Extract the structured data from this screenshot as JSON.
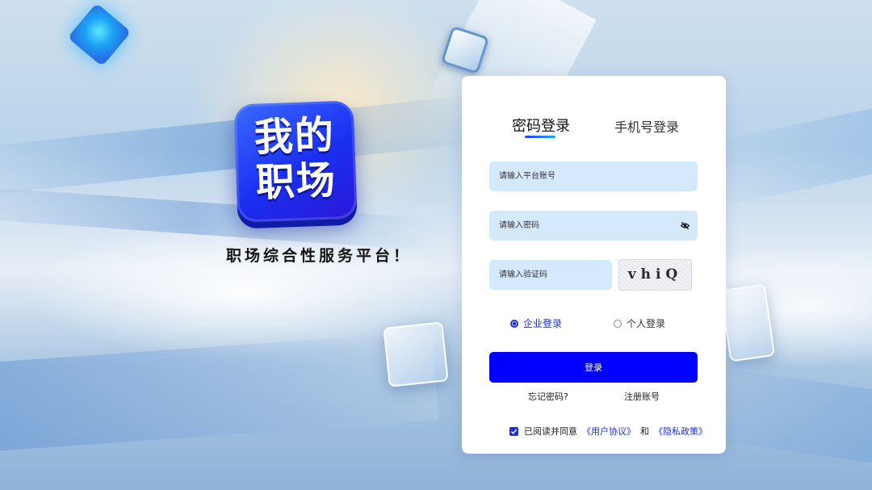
{
  "brand": {
    "logo_text": "我的\n职场",
    "slogan": "职场综合性服务平台！"
  },
  "login": {
    "tabs": [
      {
        "label": "密码登录",
        "active": true
      },
      {
        "label": "手机号登录",
        "active": false
      }
    ],
    "account_placeholder": "请输入平台账号",
    "password_placeholder": "请输入密码",
    "captcha_placeholder": "请输入验证码",
    "captcha_text": "vhiQ",
    "login_types": [
      {
        "label": "企业登录",
        "selected": true
      },
      {
        "label": "个人登录",
        "selected": false
      }
    ],
    "login_button": "登录",
    "forgot_password": "忘记密码?",
    "register": "注册账号",
    "agreement": {
      "checked": true,
      "prefix": "已阅读并同意",
      "user_agreement": "《用户协议》",
      "conjunction": "和",
      "privacy_policy": "《隐私政策》"
    }
  },
  "colors": {
    "primary": "#0000ff",
    "accent": "#1b2fe0",
    "input_bg": "#d5e9fc",
    "logo_blue": "#1a2ff0"
  },
  "icons": {
    "password_toggle": "eye-slash-icon",
    "agreement_check": "checkmark-icon"
  }
}
